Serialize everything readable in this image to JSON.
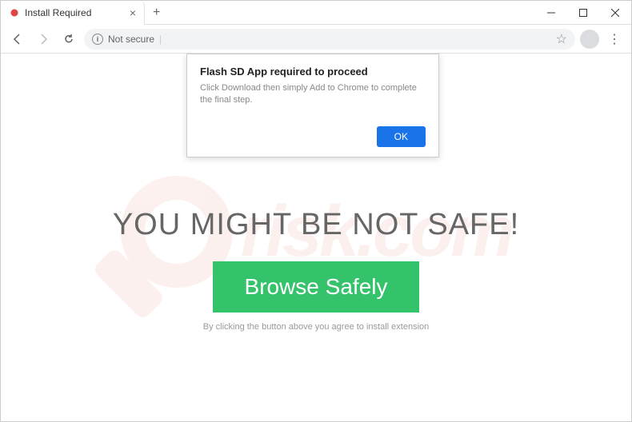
{
  "tab": {
    "title": "Install Required"
  },
  "toolbar": {
    "not_secure": "Not secure"
  },
  "popup": {
    "title": "Flash SD App required to proceed",
    "body": "Click Download then simply Add to Chrome to complete the final step.",
    "ok": "OK"
  },
  "page": {
    "headline": "YOU MIGHT BE NOT SAFE!",
    "button": "Browse Safely",
    "disclaimer": "By clicking the button above you agree to install extension"
  },
  "watermark": {
    "text": "risk.com"
  }
}
